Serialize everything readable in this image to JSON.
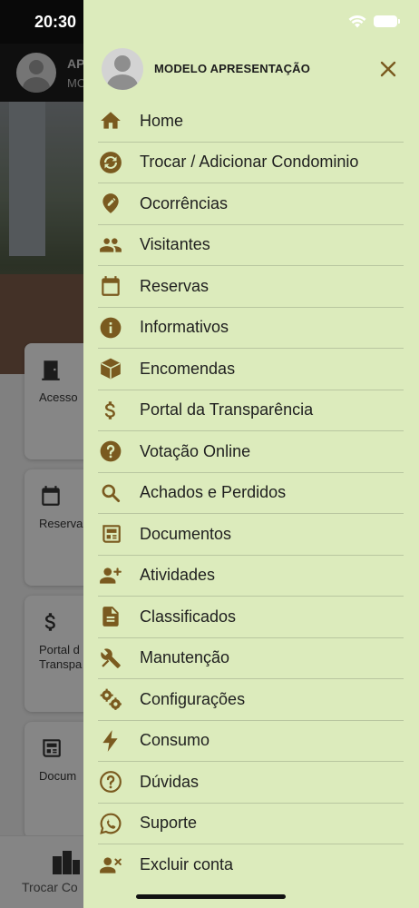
{
  "status_bar": {
    "time": "20:30"
  },
  "background_app": {
    "header_line1": "AP",
    "header_line2": "MC",
    "cards": [
      {
        "label": "Acesso",
        "icon": "door-icon"
      },
      {
        "label": "Reserva",
        "icon": "calendar-icon"
      },
      {
        "label": "Portal d\nTranspa",
        "icon": "dollar-icon"
      },
      {
        "label": "Docum",
        "icon": "newspaper-icon"
      }
    ],
    "bottom_tab_label": "Trocar Co"
  },
  "drawer": {
    "profile_name": "MODELO APRESENTAÇÃO",
    "accent_color": "#7a5a1f",
    "background_color": "#dcebbc",
    "items": [
      {
        "label": "Home",
        "icon": "home-icon"
      },
      {
        "label": "Trocar / Adicionar Condominio",
        "icon": "swap-icon"
      },
      {
        "label": "Ocorrências",
        "icon": "edit-pin-icon"
      },
      {
        "label": "Visitantes",
        "icon": "people-icon"
      },
      {
        "label": "Reservas",
        "icon": "calendar-icon"
      },
      {
        "label": "Informativos",
        "icon": "info-icon"
      },
      {
        "label": "Encomendas",
        "icon": "package-icon"
      },
      {
        "label": "Portal da Transparência",
        "icon": "dollar-icon"
      },
      {
        "label": "Votação Online",
        "icon": "help-circle-icon"
      },
      {
        "label": "Achados e Perdidos",
        "icon": "search-icon"
      },
      {
        "label": "Documentos",
        "icon": "newspaper-icon"
      },
      {
        "label": "Atividades",
        "icon": "person-add-icon"
      },
      {
        "label": "Classificados",
        "icon": "document-icon"
      },
      {
        "label": "Manutenção",
        "icon": "tools-icon"
      },
      {
        "label": "Configurações",
        "icon": "gears-icon"
      },
      {
        "label": "Consumo",
        "icon": "bolt-icon"
      },
      {
        "label": "Dúvidas",
        "icon": "question-outline-icon"
      },
      {
        "label": "Suporte",
        "icon": "whatsapp-icon"
      },
      {
        "label": "Excluir conta",
        "icon": "person-remove-icon"
      }
    ]
  }
}
